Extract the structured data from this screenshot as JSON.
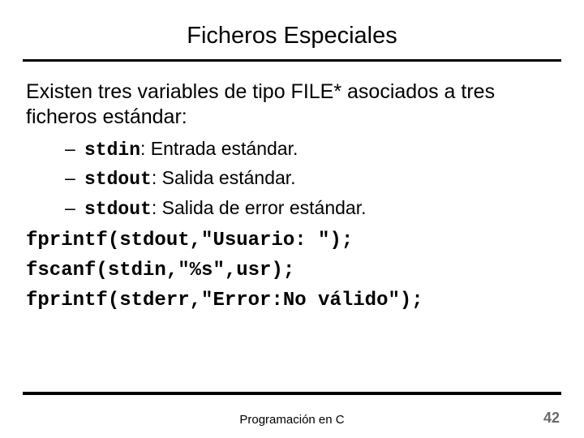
{
  "title": "Ficheros Especiales",
  "intro": "Existen tres variables de tipo FILE* asociados a tres ficheros estándar:",
  "bullets": [
    {
      "kw": "stdin",
      "desc": ": Entrada estándar."
    },
    {
      "kw": "stdout",
      "desc": ": Salida estándar."
    },
    {
      "kw": "stdout",
      "desc": ": Salida de error estándar."
    }
  ],
  "code": [
    "fprintf(stdout,\"Usuario: \");",
    "fscanf(stdin,\"%s\",usr);",
    "fprintf(stderr,\"Error:No válido\");"
  ],
  "footer": "Programación en C",
  "pagenum": "42",
  "dash": "–"
}
